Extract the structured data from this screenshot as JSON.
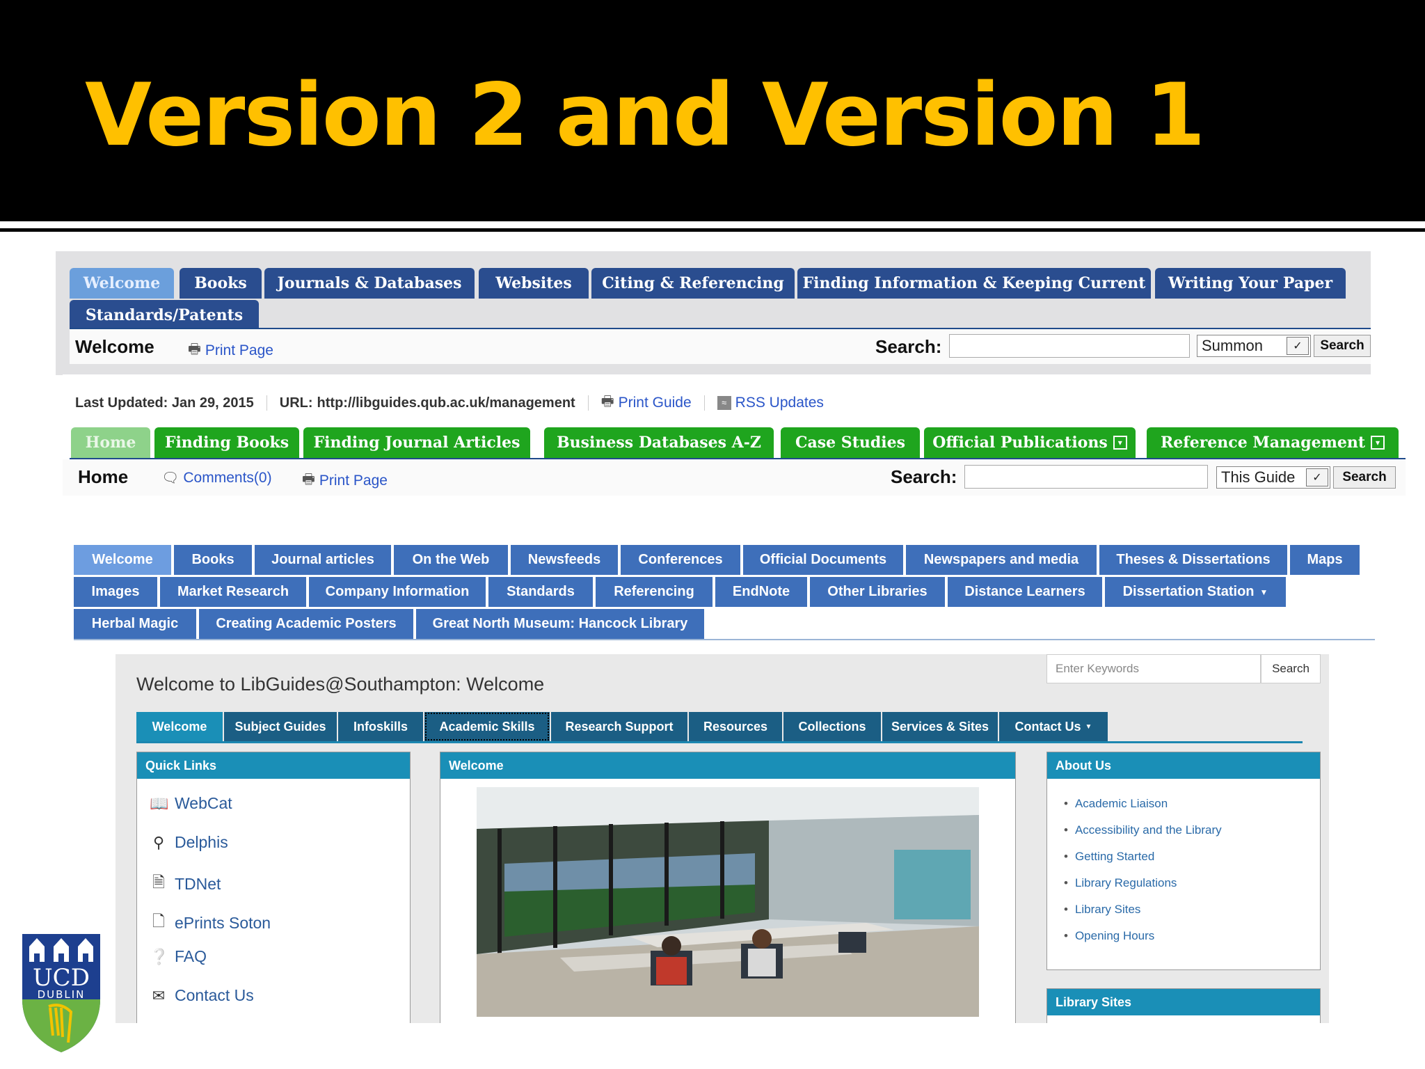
{
  "slide": {
    "title": "Version 2 and Version 1"
  },
  "version2_qub_tabs": {
    "items": [
      "Welcome",
      "Books",
      "Journals & Databases",
      "Websites",
      "Citing & Referencing",
      "Finding Information & Keeping Current",
      "Writing Your Paper",
      "Standards/Patents"
    ],
    "active": "Welcome"
  },
  "version2_qub_bar": {
    "page_title": "Welcome",
    "print_label": "Print Page",
    "search_label": "Search:",
    "search_value": "",
    "scope_selected": "Summon",
    "search_button": "Search"
  },
  "version1_qub_meta": {
    "last_updated": "Last Updated: Jan 29, 2015",
    "url_label": "URL:",
    "url_value": "http://libguides.qub.ac.uk/management",
    "print_guide": "Print Guide",
    "rss": "RSS Updates"
  },
  "version1_qub_tabs": {
    "items": [
      "Home",
      "Finding Books",
      "Finding Journal Articles",
      "Business Databases A-Z",
      "Case Studies",
      "Official Publications",
      "Reference Management"
    ],
    "active": "Home"
  },
  "version1_qub_bar": {
    "page_title": "Home",
    "comments": "Comments(0)",
    "print_label": "Print Page",
    "search_label": "Search:",
    "search_value": "",
    "scope_selected": "This Guide",
    "search_button": "Search"
  },
  "newcastle_tabs": {
    "items": [
      "Welcome",
      "Books",
      "Journal articles",
      "On the Web",
      "Newsfeeds",
      "Conferences",
      "Official Documents",
      "Newspapers and media",
      "Theses & Dissertations",
      "Maps",
      "Images",
      "Market Research",
      "Company Information",
      "Standards",
      "Referencing",
      "EndNote",
      "Other Libraries",
      "Distance Learners",
      "Dissertation Station",
      "Herbal Magic",
      "Creating Academic Posters",
      "Great North Museum: Hancock Library"
    ],
    "active": "Welcome"
  },
  "southampton": {
    "title": "Welcome to LibGuides@Southampton: Welcome",
    "search_placeholder": "Enter Keywords",
    "search_button": "Search",
    "tabs": [
      "Welcome",
      "Subject Guides",
      "Infoskills",
      "Academic Skills",
      "Research Support",
      "Resources",
      "Collections",
      "Services & Sites",
      "Contact Us"
    ],
    "active_tab": "Welcome",
    "quick_links": {
      "heading": "Quick Links",
      "items": [
        "WebCat",
        "Delphis",
        "TDNet",
        "ePrints Soton",
        "FAQ",
        "Contact Us"
      ]
    },
    "welcome_box": {
      "heading": "Welcome"
    },
    "about_us": {
      "heading": "About Us",
      "items": [
        "Academic Liaison",
        "Accessibility and the Library",
        "Getting Started",
        "Library Regulations",
        "Library Sites",
        "Opening Hours"
      ]
    },
    "library_sites": {
      "heading": "Library Sites"
    }
  },
  "logo": {
    "line1": "UCD",
    "line2": "DUBLIN"
  },
  "colors": {
    "title_gold": "#FFC000",
    "qub_blue": "#2a4d8f",
    "qub_green": "#1fa51e",
    "newcastle_blue": "#3e6fba",
    "soton_teal": "#1a8fb7",
    "link_blue": "#2a55c8"
  }
}
